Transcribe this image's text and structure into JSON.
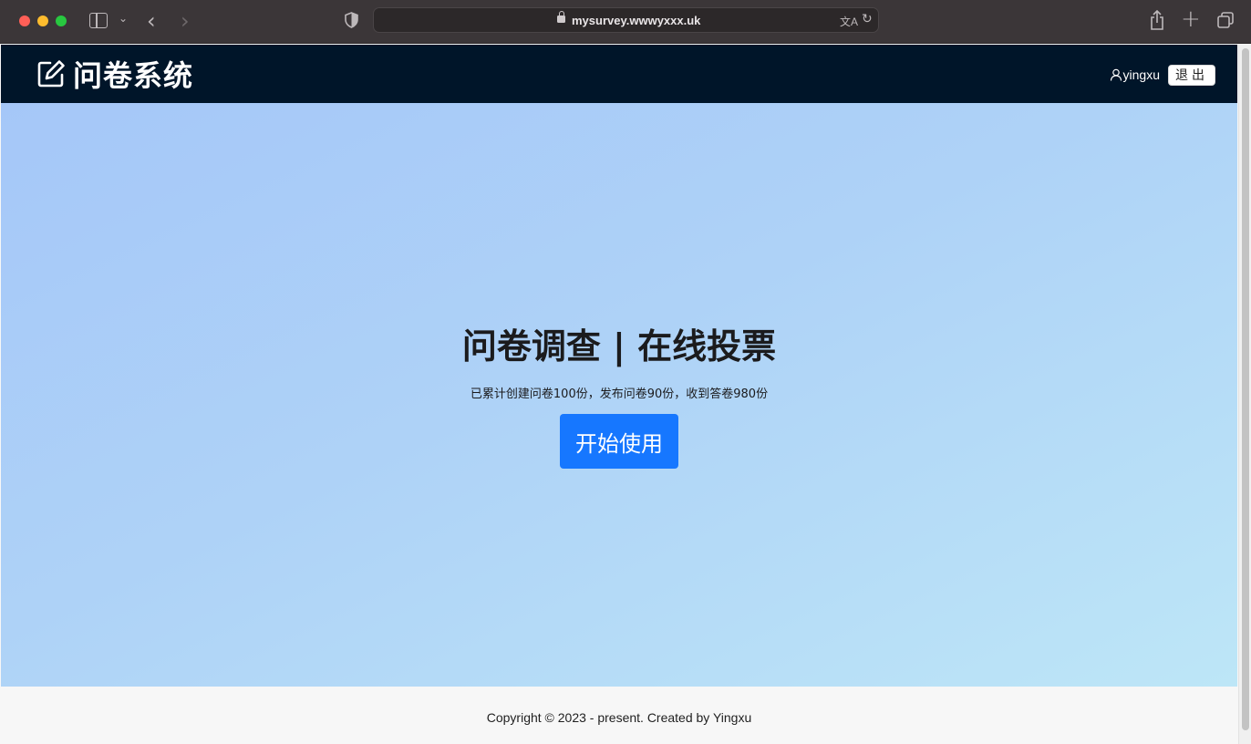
{
  "browser": {
    "url": "mysurvey.wwwyxxx.uk",
    "icons": [
      "sidebar-icon",
      "chevron-down-icon",
      "back-icon",
      "forward-icon",
      "shield-icon",
      "lock-icon",
      "translate-icon",
      "reload-icon",
      "share-icon",
      "new-tab-icon",
      "tab-overview-icon"
    ]
  },
  "header": {
    "logo_icon": "edit-icon",
    "title": "问卷系统",
    "username": "yingxu",
    "logout_label": "退出",
    "background": "#001529"
  },
  "hero": {
    "title": "问卷调查 | 在线投票",
    "subtitle": "已累计创建问卷100份，发布问卷90份，收到答卷980份",
    "start_button": "开始使用",
    "accent": "#1677ff"
  },
  "footer": {
    "copyright": "Copyright © 2023 - present. Created by Yingxu"
  }
}
